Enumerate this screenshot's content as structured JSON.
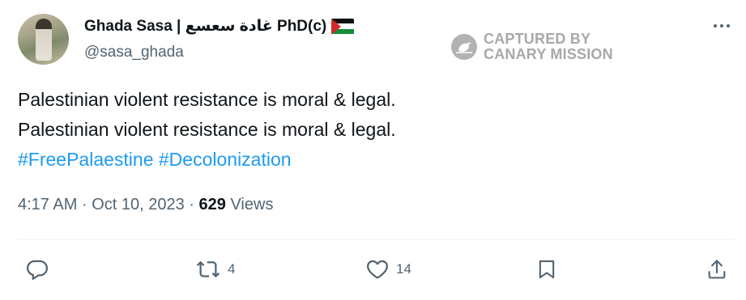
{
  "author": {
    "display_name": "Ghada Sasa | غادة سعسع PhD(c)",
    "handle": "@sasa_ghada",
    "flag_icon": "palestine-flag-icon"
  },
  "watermark": {
    "line1": "CAPTURED BY",
    "line2": "CANARY MISSION"
  },
  "tweet": {
    "lines": [
      "Palestinian violent resistance is moral & legal.",
      "Palestinian violent resistance is moral & legal."
    ],
    "hashtags": [
      "#FreePalaestine",
      "#Decolonization"
    ]
  },
  "meta": {
    "time": "4:17 AM",
    "separator": "·",
    "date": "Oct 10, 2023",
    "views_count": "629",
    "views_label": "Views"
  },
  "actions": {
    "reply_icon": "reply-icon",
    "retweet_icon": "retweet-icon",
    "retweet_count": "4",
    "like_icon": "heart-icon",
    "like_count": "14",
    "bookmark_icon": "bookmark-icon",
    "share_icon": "share-icon"
  },
  "colors": {
    "link": "#1d9bf0",
    "secondary_text": "#536471",
    "primary_text": "#0f1419"
  }
}
